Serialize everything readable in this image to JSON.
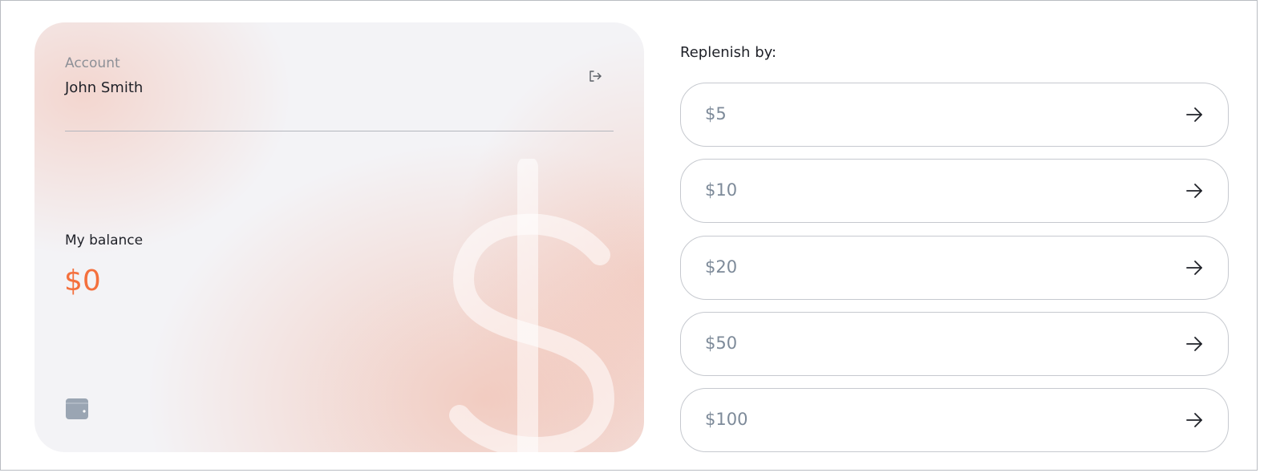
{
  "account": {
    "label": "Account",
    "name": "John Smith",
    "logout_icon": "logout-icon"
  },
  "balance": {
    "label": "My balance",
    "value": "$0",
    "value_color": "#f4703d",
    "wallet_icon": "wallet-icon"
  },
  "replenish": {
    "title": "Replenish by:",
    "options": [
      {
        "label": "$5"
      },
      {
        "label": "$10"
      },
      {
        "label": "$20"
      },
      {
        "label": "$50"
      },
      {
        "label": "$100"
      }
    ],
    "arrow_icon": "arrow-right-icon"
  },
  "colors": {
    "accent": "#f4703d",
    "card_background": "#f3f3f6",
    "amount_text": "#7d8a99",
    "border": "#c6c9cf"
  }
}
